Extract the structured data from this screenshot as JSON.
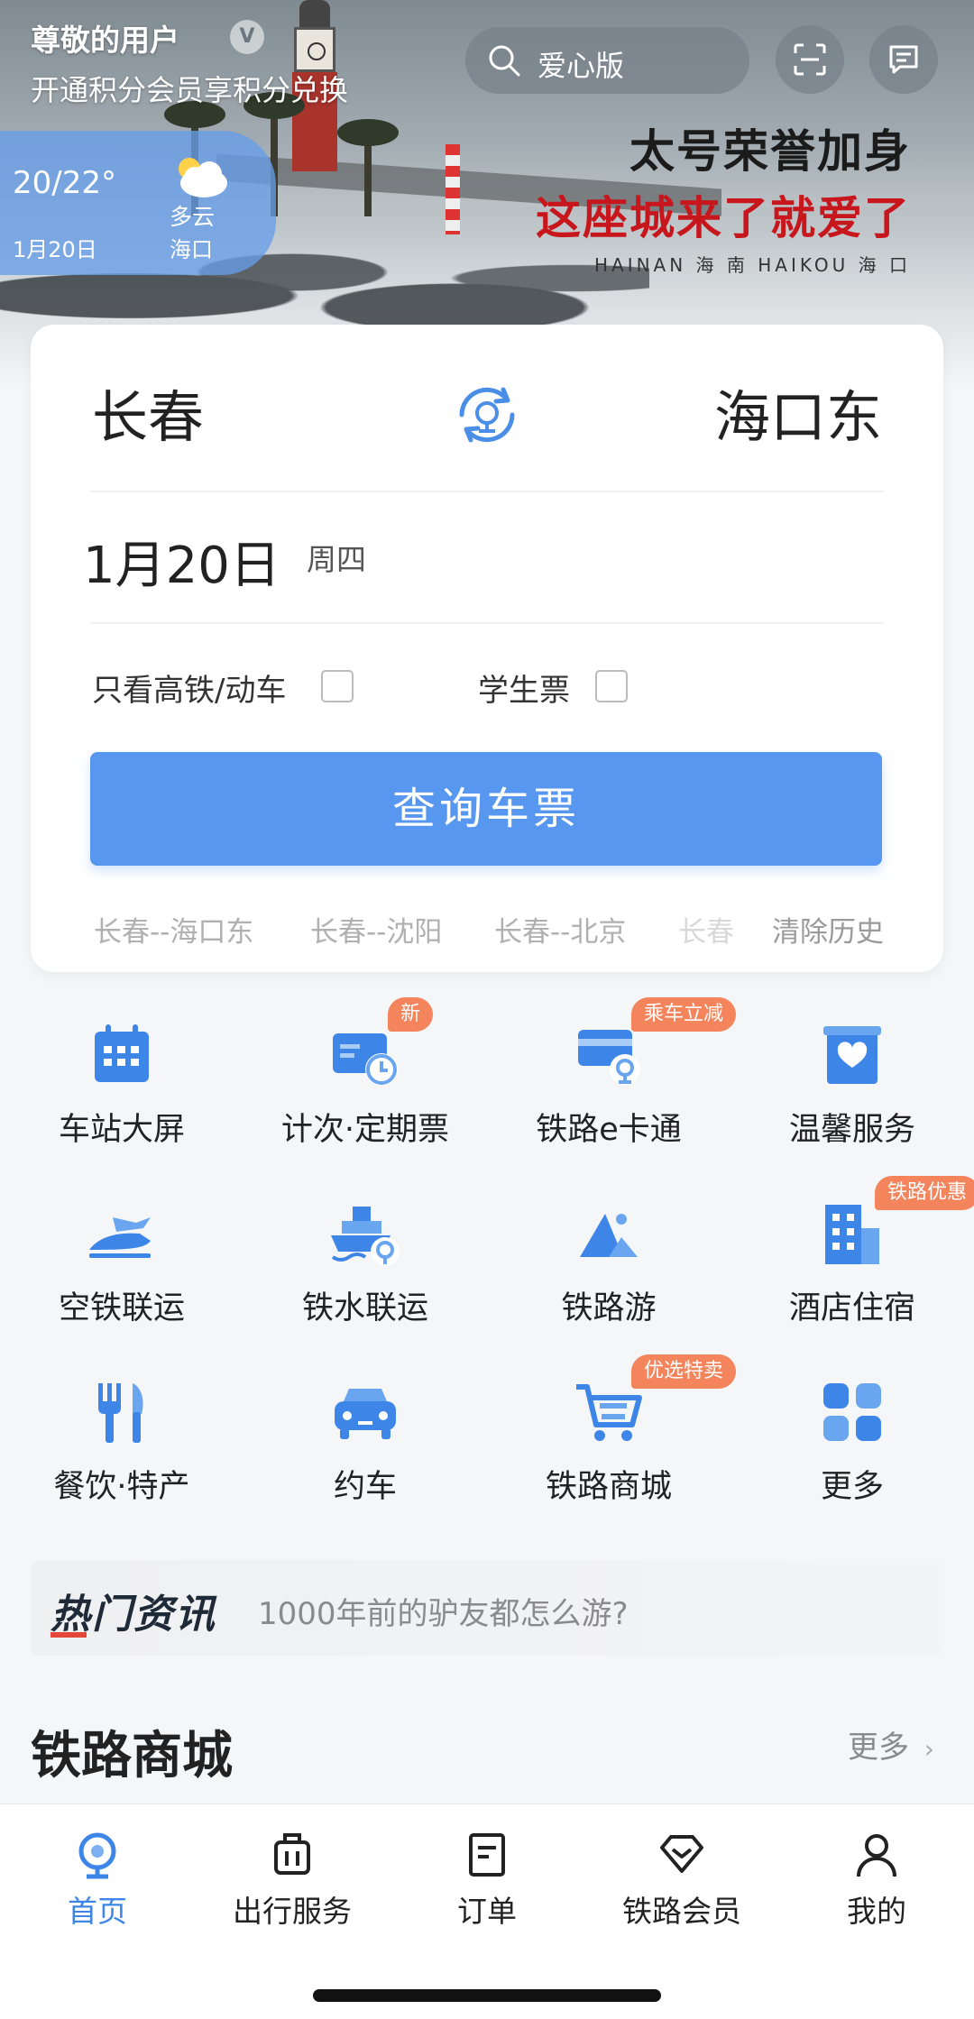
{
  "header": {
    "user_name": "尊敬的用户",
    "vip_badge": "V",
    "subtitle": "开通积分会员享积分兑换",
    "search_placeholder": "爱心版"
  },
  "weather": {
    "temp": "20/22°",
    "date": "1月20日",
    "condition": "多云",
    "city": "海口"
  },
  "banner": {
    "line1": "太号荣誉加身",
    "line2": "这座城来了就爱了",
    "line3": "HAINAN 海 南 HAIKOU 海 口"
  },
  "booking": {
    "from": "长春",
    "to": "海口东",
    "date": "1月20日",
    "weekday": "周四",
    "option_highspeed": "只看高铁/动车",
    "option_student": "学生票",
    "search_button": "查询车票",
    "history": [
      "长春--海口东",
      "长春--沈阳",
      "长春--北京",
      "长春"
    ],
    "clear_history": "清除历史"
  },
  "services": [
    {
      "label": "车站大屏",
      "icon": "calendar-screen-icon"
    },
    {
      "label": "计次·定期票",
      "icon": "periodic-ticket-icon",
      "badge": "新"
    },
    {
      "label": "铁路e卡通",
      "icon": "ecard-icon",
      "badge": "乘车立减"
    },
    {
      "label": "温馨服务",
      "icon": "heart-service-icon"
    },
    {
      "label": "空铁联运",
      "icon": "air-rail-icon"
    },
    {
      "label": "铁水联运",
      "icon": "ship-rail-icon"
    },
    {
      "label": "铁路游",
      "icon": "mountain-travel-icon"
    },
    {
      "label": "酒店住宿",
      "icon": "hotel-icon",
      "badge": "铁路优惠"
    },
    {
      "label": "餐饮·特产",
      "icon": "dining-icon"
    },
    {
      "label": "约车",
      "icon": "car-icon"
    },
    {
      "label": "铁路商城",
      "icon": "shopping-cart-icon",
      "badge": "优选特卖"
    },
    {
      "label": "更多",
      "icon": "more-grid-icon"
    }
  ],
  "news": {
    "title": "热门资讯",
    "headline": "1000年前的驴友都怎么游?"
  },
  "mall": {
    "title": "铁路商城",
    "more": "更多"
  },
  "tabs": [
    {
      "label": "首页",
      "icon": "railway-home-icon"
    },
    {
      "label": "出行服务",
      "icon": "luggage-icon"
    },
    {
      "label": "订单",
      "icon": "order-doc-icon"
    },
    {
      "label": "铁路会员",
      "icon": "diamond-icon"
    },
    {
      "label": "我的",
      "icon": "person-icon"
    }
  ],
  "colors": {
    "primary": "#5897EF",
    "active_tab": "#3D86E8",
    "badge": "#F4845C",
    "weather_bg": "#679EE8",
    "banner_red": "#C8161D"
  }
}
